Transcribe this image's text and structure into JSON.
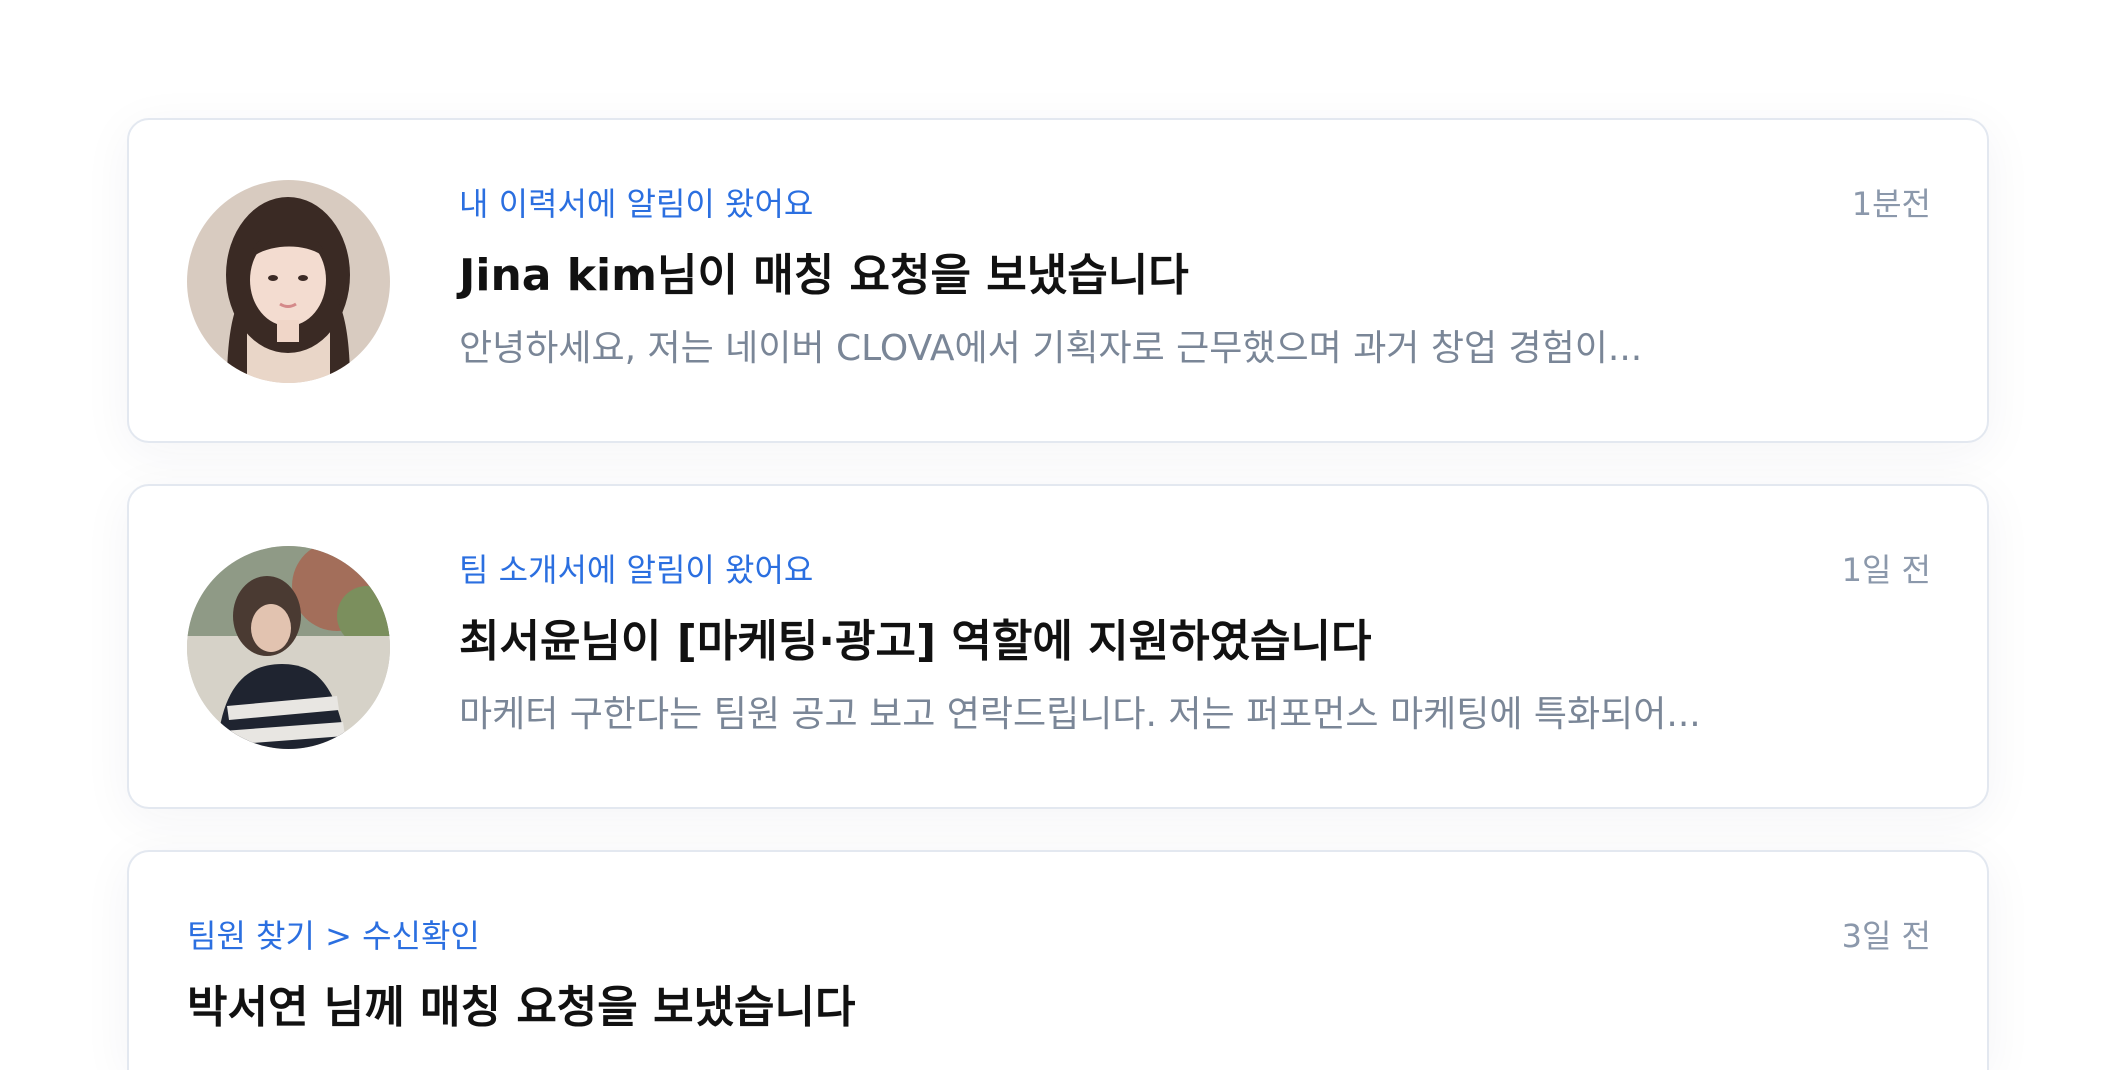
{
  "notifications": [
    {
      "category": "내 이력서에 알림이 왔어요",
      "time": "1분전",
      "title": "Jina kim님이 매칭 요청을 보냈습니다",
      "preview": "안녕하세요, 저는 네이버 CLOVA에서 기획자로 근무했으며 과거 창업 경험이..."
    },
    {
      "category": "팀 소개서에 알림이 왔어요",
      "time": "1일 전",
      "title": "최서윤님이 [마케팅·광고] 역할에 지원하였습니다",
      "preview": "마케터 구한다는 팀원 공고 보고 연락드립니다. 저는 퍼포먼스 마케팅에 특화되어..."
    },
    {
      "category": "팀원 찾기 > 수신확인",
      "time": "3일 전",
      "title": "박서연 님께 매칭 요청을 보냈습니다"
    }
  ],
  "colors": {
    "accent": "#2b6fe0",
    "muted": "#8b98ab",
    "border": "#e3e8f0"
  }
}
